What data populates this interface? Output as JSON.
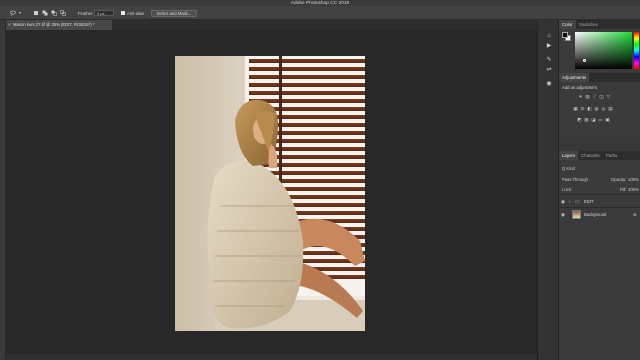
{
  "app": {
    "title": "Adobe Photoshop CC 2019"
  },
  "options_bar": {
    "feather_label": "Feather:",
    "feather_value": "0 px",
    "anti_alias_label": "Anti-alias",
    "select_mask_label": "Select and Mask..."
  },
  "document": {
    "tab_label": "Marcin kurs 27.tif @ 25% (EDIT, RGB/16*) *",
    "close_glyph": "×"
  },
  "panels": {
    "color": {
      "tabs": [
        "Color",
        "Swatches"
      ],
      "foreground": "#0a0a0a",
      "background": "#ffffff"
    },
    "adjustments": {
      "tab": "Adjustments",
      "subtitle": "Add an adjustment"
    },
    "layers": {
      "tabs": [
        "Layers",
        "Channels",
        "Paths"
      ],
      "filter_kind": "Q Kind",
      "blend_mode": "Pass Through",
      "opacity_label": "Opacity:",
      "opacity_value": "100%",
      "lock_label": "Lock:",
      "fill_label": "Fill:",
      "fill_value": "100%",
      "items": [
        {
          "name": "EDIT",
          "type": "group"
        },
        {
          "name": "Background",
          "type": "image"
        }
      ]
    }
  },
  "icons": {
    "tools_strip": [
      "lasso-icon",
      "lasso-dropdown-icon"
    ],
    "selection_modes": [
      "new-selection-icon",
      "add-selection-icon",
      "subtract-selection-icon",
      "intersect-selection-icon"
    ],
    "side_strip": [
      "history-icon",
      "play-icon",
      "brush-settings-icon",
      "properties-icon",
      "swatches-icon"
    ]
  },
  "colors": {
    "accent": "#1edc3a",
    "ui_dark": "#282828"
  }
}
